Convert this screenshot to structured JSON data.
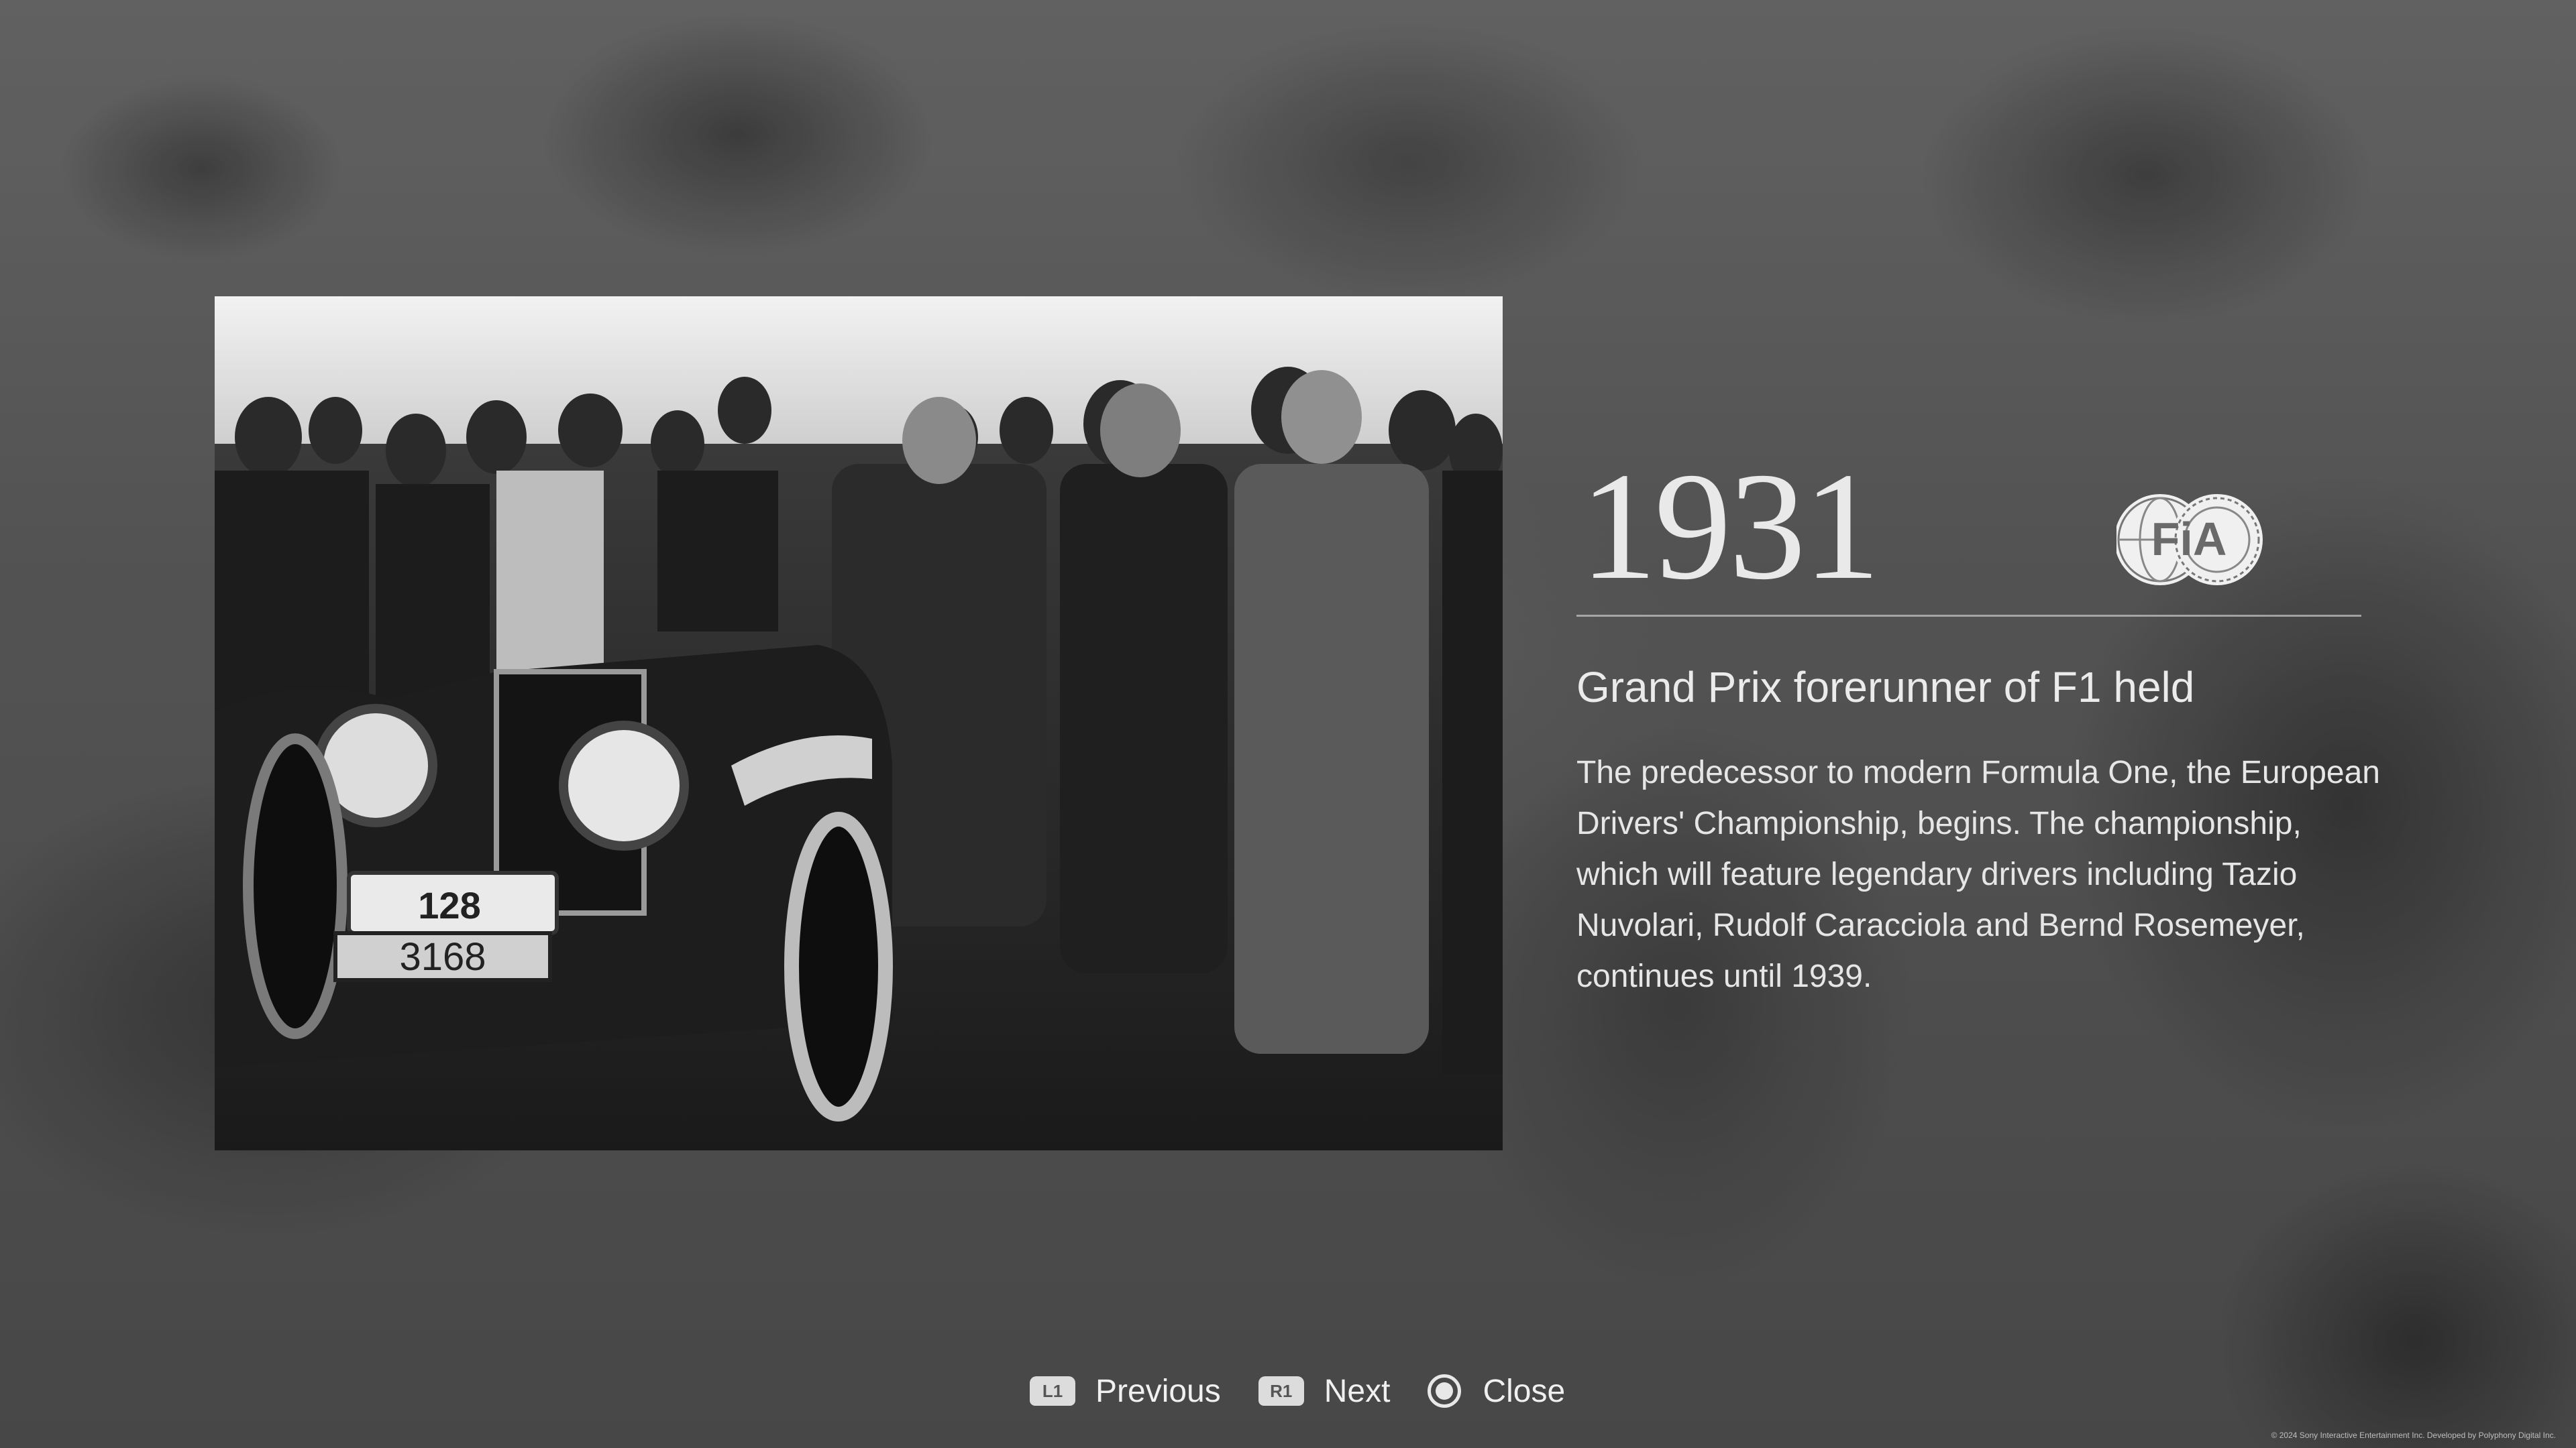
{
  "event": {
    "year": "1931",
    "logo_text": "FiA",
    "headline": "Grand Prix forerunner of F1 held",
    "body": "The predecessor to modern Formula One, the European Drivers' Championship, begins. The championship, which will feature legendary drivers including Tazio Nuvolari, Rudolf Caracciola and Bernd Rosemeyer, continues until 1939."
  },
  "photo": {
    "plate_number": "3168",
    "car_number": "128"
  },
  "controls": {
    "previous": {
      "button": "L1",
      "label": "Previous"
    },
    "next": {
      "button": "R1",
      "label": "Next"
    },
    "close": {
      "button": "circle",
      "label": "Close"
    }
  },
  "footer": {
    "copyright": "© 2024 Sony Interactive Entertainment Inc. Developed by Polyphony Digital Inc."
  }
}
